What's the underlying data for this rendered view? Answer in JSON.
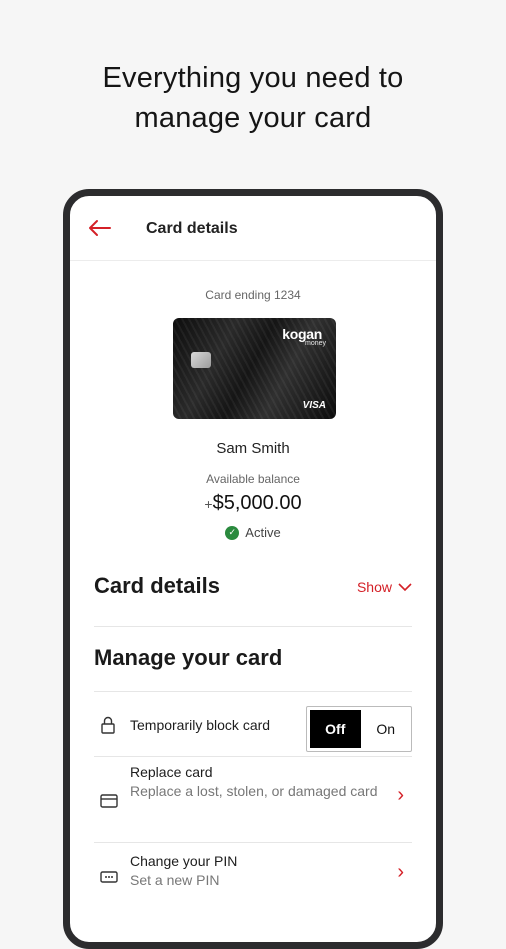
{
  "headline": {
    "line1": "Everything you need to",
    "line2": "manage your card"
  },
  "topbar": {
    "title": "Card details"
  },
  "card": {
    "ending_label": "Card ending 1234",
    "brand": "kogan",
    "brand_sub": "money",
    "network": "VISA",
    "holder": "Sam Smith",
    "balance_label": "Available balance",
    "balance_sign": "+",
    "balance": "$5,000.00",
    "status": "Active"
  },
  "card_details_section": {
    "title": "Card details",
    "show_label": "Show"
  },
  "manage": {
    "title": "Manage your card",
    "block": {
      "label": "Temporarily block card",
      "off": "Off",
      "on": "On"
    },
    "replace": {
      "label": "Replace card",
      "sub": "Replace a lost, stolen, or damaged card"
    },
    "pin": {
      "label": "Change your PIN",
      "sub": "Set a new PIN"
    }
  },
  "colors": {
    "accent": "#d42027",
    "active_green": "#2a8a3e"
  }
}
